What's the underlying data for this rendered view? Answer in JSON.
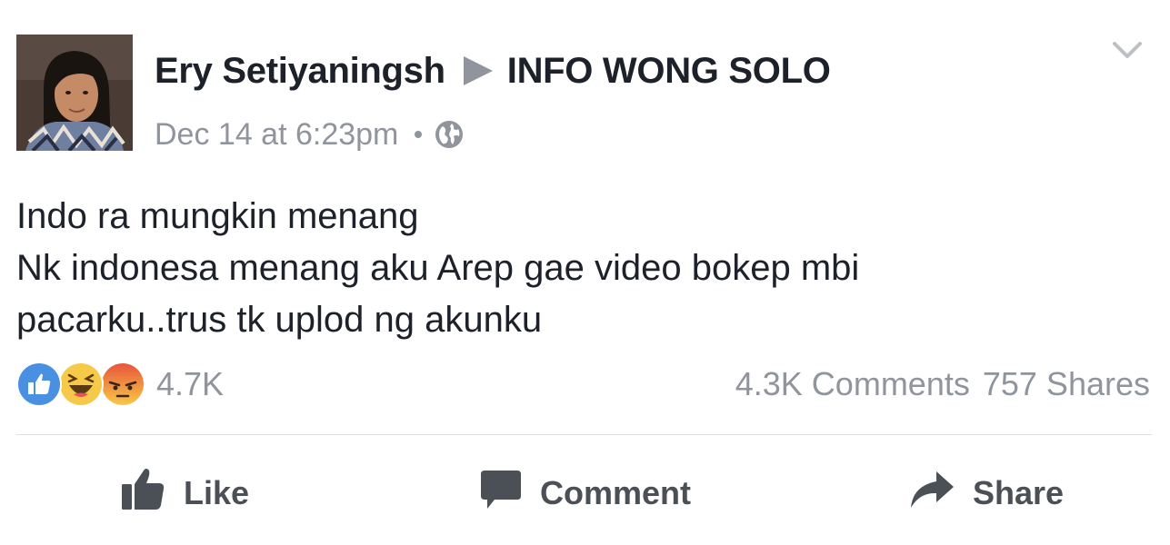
{
  "post": {
    "author": "Ery Setiyaningsh",
    "target": "INFO WONG SOLO",
    "timestamp": "Dec 14 at 6:23pm",
    "privacy_icon": "globe-icon",
    "menu_icon": "chevron-down-icon",
    "text_lines": [
      "Indo ra mungkin menang",
      "Nk indonesa menang aku Arep gae video bokep mbi",
      "pacarku..trus tk uplod ng akunku"
    ]
  },
  "reactions": {
    "icons": [
      "like-reaction-icon",
      "haha-reaction-icon",
      "angry-reaction-icon"
    ],
    "count": "4.7K"
  },
  "engagement": {
    "comments": "4.3K Comments",
    "shares": "757 Shares"
  },
  "actions": {
    "like": "Like",
    "comment": "Comment",
    "share": "Share"
  },
  "colors": {
    "text": "#1d2129",
    "secondary": "#90949c",
    "action": "#4b4f56",
    "like_blue": "#4a90e2",
    "haha_yellow": "#f7c948",
    "angry_orange": "#f28a2e",
    "divider": "#dddfe2"
  }
}
